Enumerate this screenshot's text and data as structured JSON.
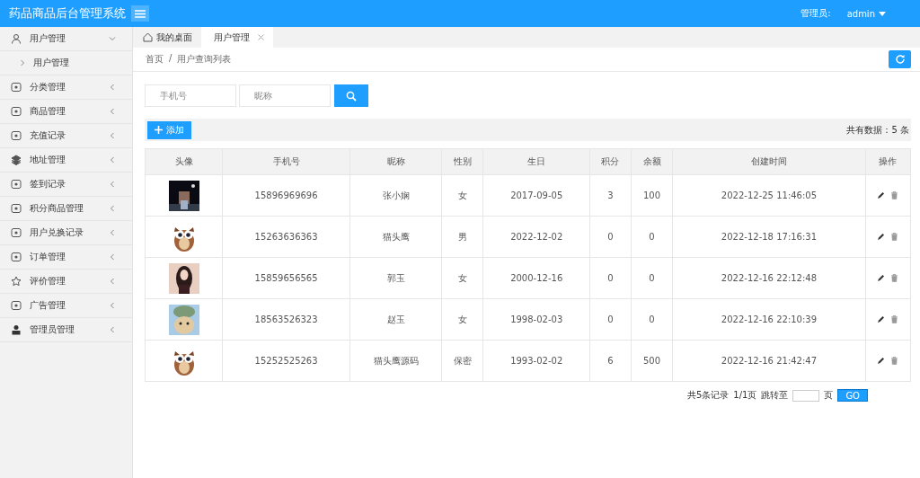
{
  "header": {
    "title": "药品商品后台管理系统",
    "user_label": "管理员:",
    "user_name": "admin"
  },
  "sidebar": {
    "items": [
      {
        "label": "用户管理",
        "expanded": true,
        "children": [
          {
            "label": "用户管理"
          }
        ]
      },
      {
        "label": "分类管理",
        "expanded": false
      },
      {
        "label": "商品管理",
        "expanded": false
      },
      {
        "label": "充值记录",
        "expanded": false
      },
      {
        "label": "地址管理",
        "expanded": false
      },
      {
        "label": "签到记录",
        "expanded": false
      },
      {
        "label": "积分商品管理",
        "expanded": false
      },
      {
        "label": "用户兑换记录",
        "expanded": false
      },
      {
        "label": "订单管理",
        "expanded": false
      },
      {
        "label": "评价管理",
        "expanded": false
      },
      {
        "label": "广告管理",
        "expanded": false
      },
      {
        "label": "管理员管理",
        "expanded": false
      }
    ]
  },
  "tabs": [
    {
      "label": "我的桌面",
      "selected": false,
      "closable": false
    },
    {
      "label": "用户管理",
      "selected": true,
      "closable": true
    }
  ],
  "breadcrumb": {
    "separator": "/",
    "items": [
      "首页",
      "用户查询列表"
    ]
  },
  "search": {
    "fields": [
      {
        "placeholder": "手机号"
      },
      {
        "placeholder": "昵称"
      }
    ]
  },
  "toolbar": {
    "add_button": "添加",
    "total": "共有数据：5 条"
  },
  "table": {
    "columns": [
      "头像",
      "手机号",
      "昵称",
      "性别",
      "生日",
      "积分",
      "余额",
      "创建时间",
      "操作"
    ],
    "rows": [
      {
        "phone": "15896969696",
        "nickname": "张小娴",
        "gender": "女",
        "birthday": "2017-09-05",
        "points": "3",
        "balance": "100",
        "created": "2022-12-25 11:46:05"
      },
      {
        "phone": "15263636363",
        "nickname": "猫头鹰",
        "gender": "男",
        "birthday": "2022-12-02",
        "points": "0",
        "balance": "0",
        "created": "2022-12-18 17:16:31"
      },
      {
        "phone": "15859656565",
        "nickname": "郭玉",
        "gender": "女",
        "birthday": "2000-12-16",
        "points": "0",
        "balance": "0",
        "created": "2022-12-16 22:12:48"
      },
      {
        "phone": "18563526323",
        "nickname": "赵玉",
        "gender": "女",
        "birthday": "1998-02-03",
        "points": "0",
        "balance": "0",
        "created": "2022-12-16 22:10:39"
      },
      {
        "phone": "15252525263",
        "nickname": "猫头鹰源码",
        "gender": "保密",
        "birthday": "1993-02-02",
        "points": "6",
        "balance": "500",
        "created": "2022-12-16 21:42:47"
      }
    ]
  },
  "pagination": {
    "summary": "共5条记录",
    "pages": "1/1页",
    "jump_label": "跳转至",
    "page_suffix": "页",
    "go_button": "GO"
  }
}
